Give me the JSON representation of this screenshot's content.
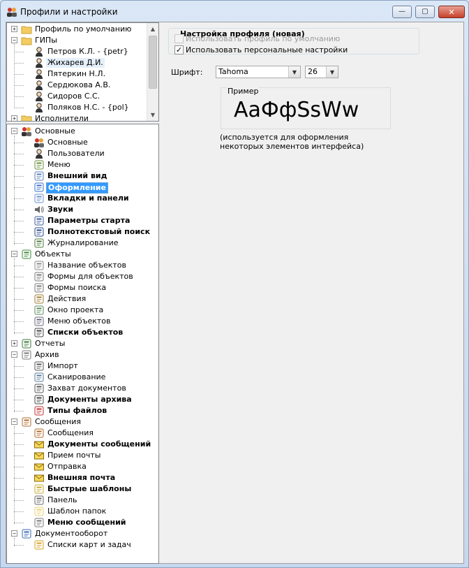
{
  "window": {
    "title": "Профили и настройки",
    "min_glyph": "—",
    "max_glyph": "▢",
    "close_glyph": "✕"
  },
  "profiles_tree": [
    {
      "label": "Профиль по умолчанию",
      "level": 0,
      "expander": "+",
      "icon": "folder-icon"
    },
    {
      "label": "ГИПы",
      "level": 0,
      "expander": "−",
      "icon": "folder-icon"
    },
    {
      "label": "Петров К.Л. - {petr}",
      "level": 1,
      "icon": "user-icon"
    },
    {
      "label": "Жихарев Д.И.",
      "level": 1,
      "icon": "user-icon",
      "highlighted": true
    },
    {
      "label": "Пятеркин Н.Л.",
      "level": 1,
      "icon": "user-icon"
    },
    {
      "label": "Сердюкова А.В.",
      "level": 1,
      "icon": "user-icon"
    },
    {
      "label": "Сидоров С.С.",
      "level": 1,
      "icon": "user-icon"
    },
    {
      "label": "Поляков Н.С. - {pol}",
      "level": 1,
      "icon": "user-icon"
    },
    {
      "label": "Исполнители",
      "level": 0,
      "expander": "+",
      "icon": "folder-icon"
    }
  ],
  "nav_tree": [
    {
      "label": "Основные",
      "level": 0,
      "expander": "−",
      "icon": "users-group-icon"
    },
    {
      "label": "Основные",
      "level": 1,
      "icon": "users-group-icon"
    },
    {
      "label": "Пользователи",
      "level": 1,
      "icon": "user-icon"
    },
    {
      "label": "Меню",
      "level": 1,
      "icon": "menu-icon"
    },
    {
      "label": "Внешний вид",
      "level": 1,
      "icon": "appearance-icon",
      "bold": true
    },
    {
      "label": "Оформление",
      "level": 1,
      "icon": "style-icon",
      "bold": true,
      "selected": true
    },
    {
      "label": "Вкладки и панели",
      "level": 1,
      "icon": "tabs-icon",
      "bold": true
    },
    {
      "label": "Звуки",
      "level": 1,
      "icon": "speaker-icon",
      "bold": true
    },
    {
      "label": "Параметры старта",
      "level": 1,
      "icon": "start-icon",
      "bold": true
    },
    {
      "label": "Полнотекстовый поиск",
      "level": 1,
      "icon": "binoculars-icon",
      "bold": true
    },
    {
      "label": "Журналирование",
      "level": 1,
      "icon": "log-icon"
    },
    {
      "label": "Объекты",
      "level": 0,
      "expander": "−",
      "icon": "objects-icon"
    },
    {
      "label": "Название объектов",
      "level": 1,
      "icon": "speech-icon"
    },
    {
      "label": "Формы для объектов",
      "level": 1,
      "icon": "form-icon"
    },
    {
      "label": "Формы поиска",
      "level": 1,
      "icon": "search-form-icon"
    },
    {
      "label": "Действия",
      "level": 1,
      "icon": "action-icon"
    },
    {
      "label": "Окно проекта",
      "level": 1,
      "icon": "project-icon"
    },
    {
      "label": "Меню объектов",
      "level": 1,
      "icon": "object-menu-icon"
    },
    {
      "label": "Списки объектов",
      "level": 1,
      "icon": "list-icon",
      "bold": true
    },
    {
      "label": "Отчеты",
      "level": 0,
      "expander": "+",
      "icon": "report-icon"
    },
    {
      "label": "Архив",
      "level": 0,
      "expander": "−",
      "icon": "archive-icon"
    },
    {
      "label": "Импорт",
      "level": 1,
      "icon": "import-icon"
    },
    {
      "label": "Сканирование",
      "level": 1,
      "icon": "scan-icon"
    },
    {
      "label": "Захват документов",
      "level": 1,
      "icon": "capture-icon"
    },
    {
      "label": "Документы архива",
      "level": 1,
      "icon": "doc-archive-icon",
      "bold": true
    },
    {
      "label": "Типы файлов",
      "level": 1,
      "icon": "file-types-icon",
      "bold": true
    },
    {
      "label": "Сообщения",
      "level": 0,
      "expander": "−",
      "icon": "messages-icon"
    },
    {
      "label": "Сообщения",
      "level": 1,
      "icon": "messages-icon"
    },
    {
      "label": "Документы сообщений",
      "level": 1,
      "icon": "msg-docs-icon",
      "bold": true
    },
    {
      "label": "Прием почты",
      "level": 1,
      "icon": "receive-mail-icon"
    },
    {
      "label": "Отправка",
      "level": 1,
      "icon": "send-icon"
    },
    {
      "label": "Внешняя почта",
      "level": 1,
      "icon": "envelope-icon",
      "bold": true
    },
    {
      "label": "Быстрые шаблоны",
      "level": 1,
      "icon": "templates-icon",
      "bold": true
    },
    {
      "label": "Панель",
      "level": 1,
      "icon": "panel-icon"
    },
    {
      "label": "Шаблон папок",
      "level": 1,
      "icon": "folder-template-icon"
    },
    {
      "label": "Меню сообщений",
      "level": 1,
      "icon": "msg-menu-icon",
      "bold": true
    },
    {
      "label": "Документооборот",
      "level": 0,
      "expander": "−",
      "icon": "workflow-icon"
    },
    {
      "label": "Списки карт и задач",
      "level": 1,
      "icon": "tasks-icon"
    }
  ],
  "settings": {
    "group_title": "Настройка профиля (новая)",
    "use_default": {
      "label": "Использовать профиль по умолчанию",
      "checked": false,
      "enabled": false
    },
    "use_personal": {
      "label": "Использовать персональные настройки",
      "checked": true,
      "check_glyph": "✓"
    },
    "font_label": "Шрифт:",
    "font_name": "Tahoma",
    "font_size": "26",
    "sample_title": "Пример",
    "sample_text": "AaФфSsWw",
    "note": "(используется для оформления некоторых элементов интерфейса)"
  },
  "colors": {
    "selection": "#3399ff",
    "window_frame": "#c6d8ee",
    "tree_line": "#a0a0a0"
  }
}
